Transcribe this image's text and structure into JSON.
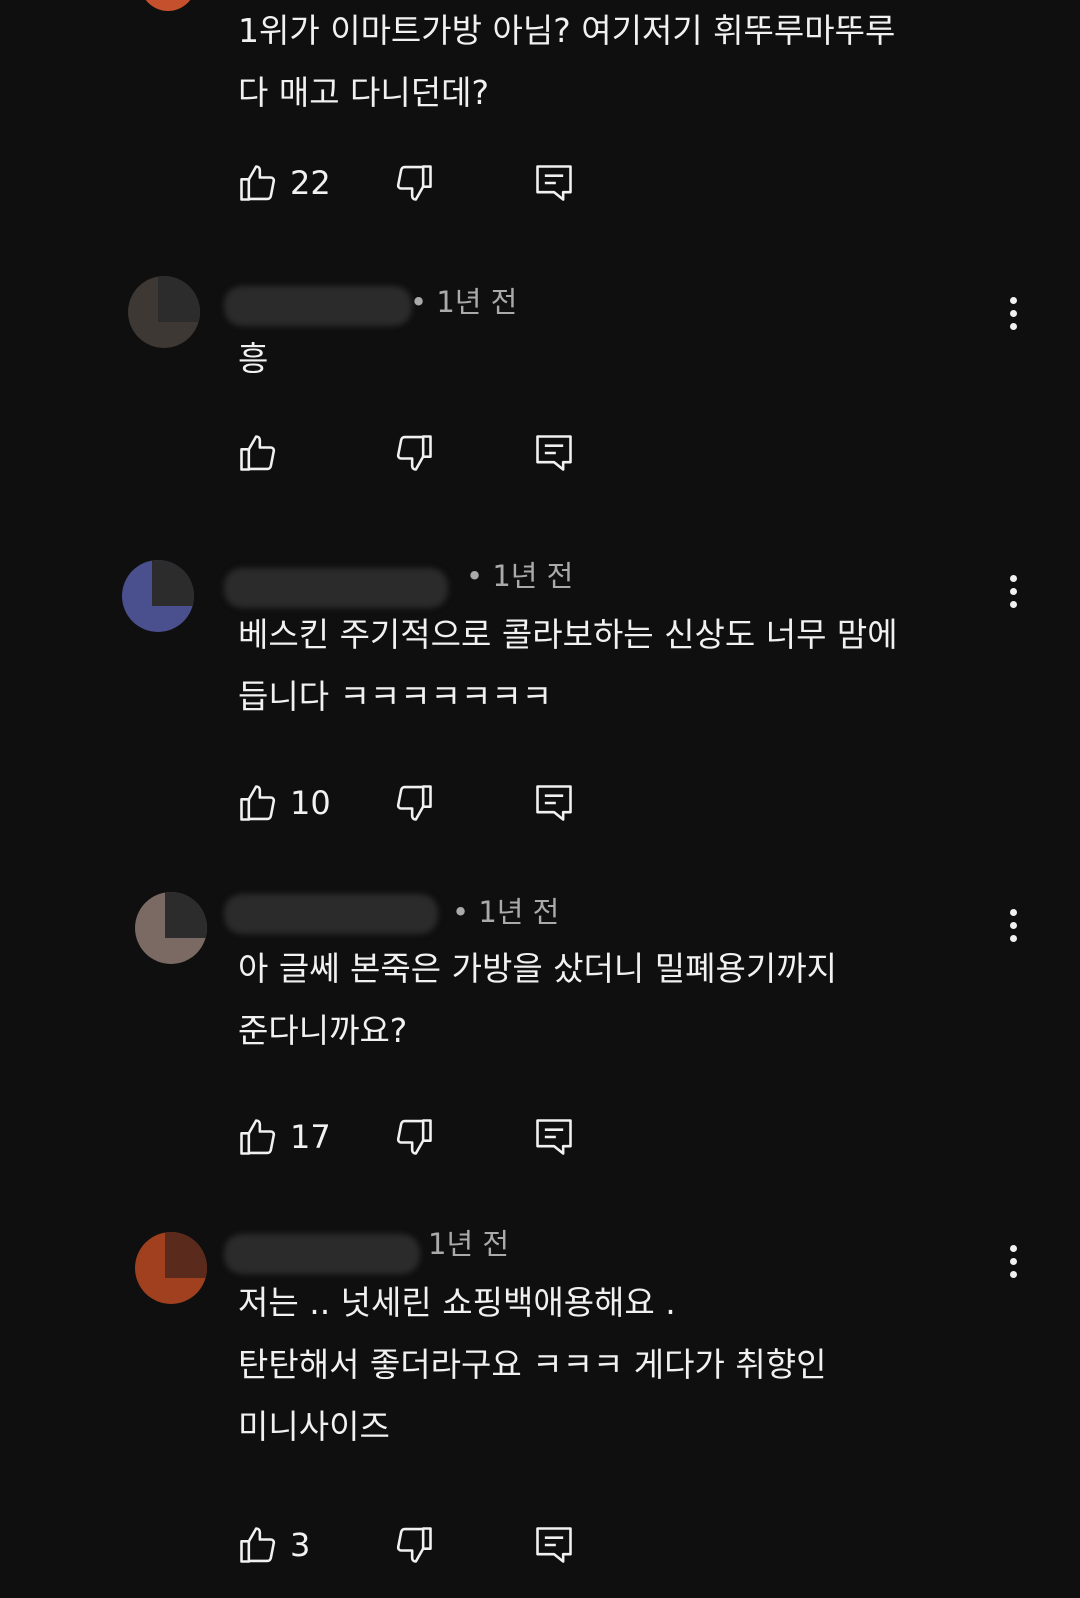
{
  "comments": [
    {
      "author_partial": "",
      "time": "",
      "text": "1위가 이마트가방 아님? 여기저기 휘뚜루마뚜루\n다 매고 다니던데?",
      "likes": "22",
      "avatar_color": "#c5502e"
    },
    {
      "author_partial": "@",
      "time": "• 1년 전",
      "text": "흥",
      "likes": "",
      "avatar_color": "#3d3834"
    },
    {
      "author_partial": "@maruij",
      "time": "• 1년 전",
      "text": "베스킨 주기적으로 콜라보하는 신상도 너무 맘에\n듭니다 ㅋㅋㅋㅋㅋㅋㅋ",
      "likes": "10",
      "avatar_color": "#4a4f8e"
    },
    {
      "author_partial": "na",
      "time": "• 1년 전",
      "text": "아 글쎄 본죽은 가방을 샀더니 밀폐용기까지\n준다니까요?",
      "likes": "17",
      "avatar_color": "#7a6a63"
    },
    {
      "author_partial": "@",
      "time": "1년 전",
      "text": "저는 .. 넛세린 쇼핑백애용해요 .\n탄탄해서 좋더라구요 ㅋㅋㅋ 게다가 취향인\n미니사이즈",
      "likes": "3",
      "avatar_color": "#a0401f"
    }
  ],
  "icons": {
    "like": "thumbs-up-icon",
    "dislike": "thumbs-down-icon",
    "reply": "reply-comment-icon",
    "more": "more-vertical-icon"
  }
}
